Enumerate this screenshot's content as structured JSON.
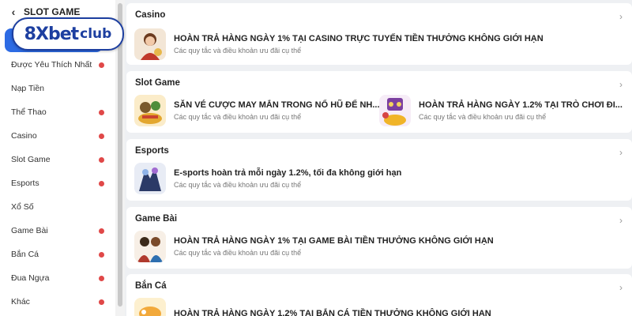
{
  "sidebar": {
    "header_title": "SLOT GAME",
    "items": [
      {
        "label": "Được Yêu Thích Nhất",
        "dot": true
      },
      {
        "label": "Nạp Tiền",
        "dot": false
      },
      {
        "label": "Thể Thao",
        "dot": true
      },
      {
        "label": "Casino",
        "dot": true
      },
      {
        "label": "Slot Game",
        "dot": true
      },
      {
        "label": "Esports",
        "dot": true
      },
      {
        "label": "Xổ Số",
        "dot": false
      },
      {
        "label": "Game Bài",
        "dot": true
      },
      {
        "label": "Bắn Cá",
        "dot": true
      },
      {
        "label": "Đua Ngựa",
        "dot": true
      },
      {
        "label": "Khác",
        "dot": true
      }
    ]
  },
  "logo": {
    "main": "8Xbet",
    "sub": "club"
  },
  "sections": [
    {
      "title": "Casino",
      "promos": [
        {
          "title": "HOÀN TRẢ HÀNG NGÀY 1% TẠI CASINO TRỰC TUYẾN TIỀN THƯỞNG KHÔNG GIỚI HẠN",
          "subtitle": "Các quy tắc và điều khoản ưu đãi cụ thể"
        }
      ]
    },
    {
      "title": "Slot Game",
      "promos": [
        {
          "title": "SĂN VÉ CƯỢC MAY MẮN TRONG NỔ HŨ ĐỂ NH...",
          "subtitle": "Các quy tắc và điều khoản ưu đãi cụ thể"
        },
        {
          "title": "HOÀN TRẢ HÀNG NGÀY 1.2% TẠI TRÒ CHƠI ĐI...",
          "subtitle": "Các quy tắc và điều khoản ưu đãi cụ thể"
        }
      ]
    },
    {
      "title": "Esports",
      "promos": [
        {
          "title": "E-sports hoàn trả mỗi ngày 1.2%, tối đa không giới hạn",
          "subtitle": "Các quy tắc và điều khoản ưu đãi cụ thể"
        }
      ]
    },
    {
      "title": "Game Bài",
      "promos": [
        {
          "title": "HOÀN TRẢ HÀNG NGÀY 1% TẠI GAME BÀI TIỀN THƯỞNG KHÔNG GIỚI HẠN",
          "subtitle": "Các quy tắc và điều khoản ưu đãi cụ thể"
        }
      ]
    },
    {
      "title": "Bắn Cá",
      "promos": [
        {
          "title": "HOÀN TRẢ HÀNG NGÀY 1.2% TẠI BẮN CÁ TIỀN THƯỞNG KHÔNG GIỚI HẠN",
          "subtitle": ""
        }
      ]
    }
  ],
  "colors": {
    "accent": "#2d6be4",
    "dot": "#e04848",
    "logo": "#1d3fa0"
  }
}
